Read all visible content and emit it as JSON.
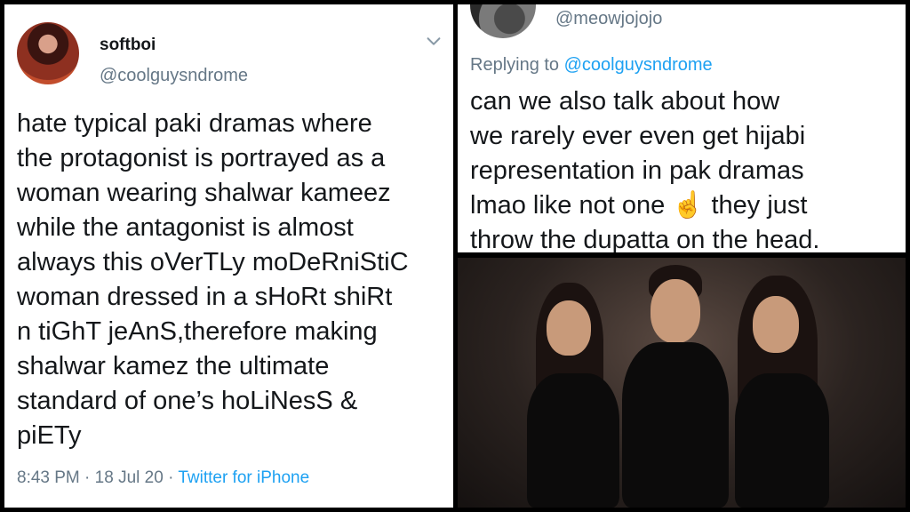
{
  "left_tweet": {
    "display_name": "softboi",
    "handle": "@coolguysndrome",
    "text": "hate typical paki dramas where\nthe protagonist is portrayed as a\nwoman wearing shalwar kameez\nwhile the antagonist is almost\nalways this oVerTLy moDeRniStiC\nwoman dressed in a sHoRt shiRt\nn tiGhT jeAnS,therefore making\nshalwar kamez the ultimate\nstandard of one’s hoLiNesS &\npiETy",
    "time": "8:43 PM",
    "date": "18 Jul 20",
    "source": "Twitter for iPhone",
    "separator": "·"
  },
  "reply_tweet": {
    "handle": "@meowjojojo",
    "replying_prefix": "Replying to",
    "replying_to": "@coolguysndrome",
    "text": "can we also talk about how\nwe rarely ever even get hijabi\nrepresentation in pak dramas\nlmao like not one ☝️ they just\nthrow the dupatta on the head."
  },
  "colors": {
    "text": "#14171a",
    "secondary": "#657786",
    "link": "#1da1f2",
    "border": "#000000"
  },
  "icons": {
    "chevron": "chevron-down-icon"
  }
}
